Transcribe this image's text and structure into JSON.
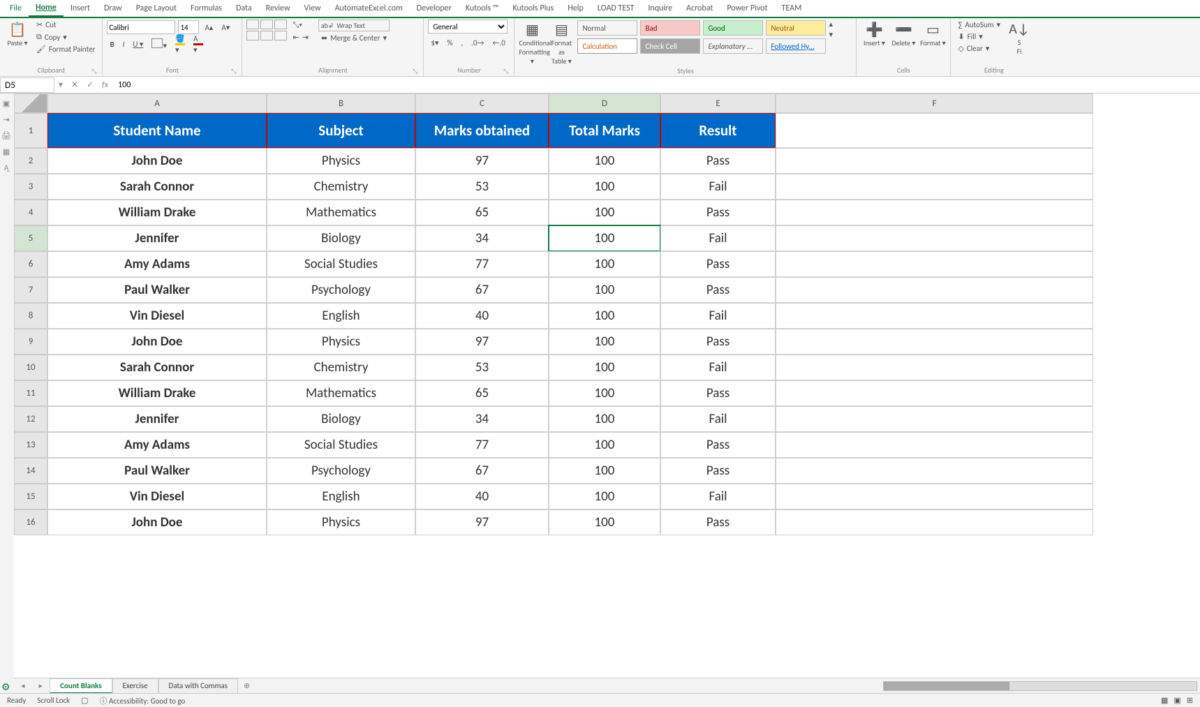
{
  "ribbonTabs": [
    "File",
    "Home",
    "Insert",
    "Draw",
    "Page Layout",
    "Formulas",
    "Data",
    "Review",
    "View",
    "AutomateExcel.com",
    "Developer",
    "Kutools ™",
    "Kutools Plus",
    "Help",
    "LOAD TEST",
    "Inquire",
    "Acrobat",
    "Power Pivot",
    "TEAM"
  ],
  "activeTab": "Home",
  "clipboard": {
    "paste": "Paste",
    "cut": "Cut",
    "copy": "Copy",
    "painter": "Format Painter",
    "label": "Clipboard"
  },
  "font": {
    "name": "Calibri",
    "size": "14",
    "label": "Font"
  },
  "alignment": {
    "wrap": "Wrap Text",
    "merge": "Merge & Center",
    "label": "Alignment"
  },
  "number": {
    "format": "General",
    "label": "Number"
  },
  "styles": {
    "cond": "Conditional\nFormatting",
    "table": "Format as\nTable",
    "cells": [
      "Normal",
      "Bad",
      "Good",
      "Neutral",
      "Calculation",
      "Check Cell",
      "Explanatory ...",
      "Followed Hy..."
    ],
    "label": "Styles"
  },
  "cells": {
    "insert": "Insert",
    "delete": "Delete",
    "format": "Format",
    "label": "Cells"
  },
  "editing": {
    "sum": "AutoSum",
    "fill": "Fill",
    "clear": "Clear",
    "sort": "Sort & Filter",
    "label": "Editing"
  },
  "nameBox": "D5",
  "formula": "100",
  "columns": [
    "A",
    "B",
    "C",
    "D",
    "E",
    "F"
  ],
  "headerRow": [
    "Student Name",
    "Subject",
    "Marks obtained",
    "Total Marks",
    "Result"
  ],
  "rows": [
    {
      "n": "John Doe",
      "s": "Physics",
      "m": "97",
      "t": "100",
      "r": "Pass"
    },
    {
      "n": "Sarah Connor",
      "s": "Chemistry",
      "m": "53",
      "t": "100",
      "r": "Fail"
    },
    {
      "n": "William Drake",
      "s": "Mathematics",
      "m": "65",
      "t": "100",
      "r": "Pass"
    },
    {
      "n": "Jennifer",
      "s": "Biology",
      "m": "34",
      "t": "100",
      "r": "Fail"
    },
    {
      "n": "Amy Adams",
      "s": "Social Studies",
      "m": "77",
      "t": "100",
      "r": "Pass"
    },
    {
      "n": "Paul Walker",
      "s": "Psychology",
      "m": "67",
      "t": "100",
      "r": "Pass"
    },
    {
      "n": "Vin Diesel",
      "s": "English",
      "m": "40",
      "t": "100",
      "r": "Fail"
    },
    {
      "n": "John Doe",
      "s": "Physics",
      "m": "97",
      "t": "100",
      "r": "Pass"
    },
    {
      "n": "Sarah Connor",
      "s": "Chemistry",
      "m": "53",
      "t": "100",
      "r": "Fail"
    },
    {
      "n": "William Drake",
      "s": "Mathematics",
      "m": "65",
      "t": "100",
      "r": "Pass"
    },
    {
      "n": "Jennifer",
      "s": "Biology",
      "m": "34",
      "t": "100",
      "r": "Fail"
    },
    {
      "n": "Amy Adams",
      "s": "Social Studies",
      "m": "77",
      "t": "100",
      "r": "Pass"
    },
    {
      "n": "Paul Walker",
      "s": "Psychology",
      "m": "67",
      "t": "100",
      "r": "Pass"
    },
    {
      "n": "Vin Diesel",
      "s": "English",
      "m": "40",
      "t": "100",
      "r": "Fail"
    },
    {
      "n": "John Doe",
      "s": "Physics",
      "m": "97",
      "t": "100",
      "r": "Pass"
    }
  ],
  "selectedCell": {
    "row": 5,
    "col": "D"
  },
  "sheetTabs": [
    "Count Blanks",
    "Exercise",
    "Data with Commas"
  ],
  "activeSheet": "Count Blanks",
  "status": {
    "ready": "Ready",
    "scroll": "Scroll Lock",
    "access": "Accessibility: Good to go"
  }
}
